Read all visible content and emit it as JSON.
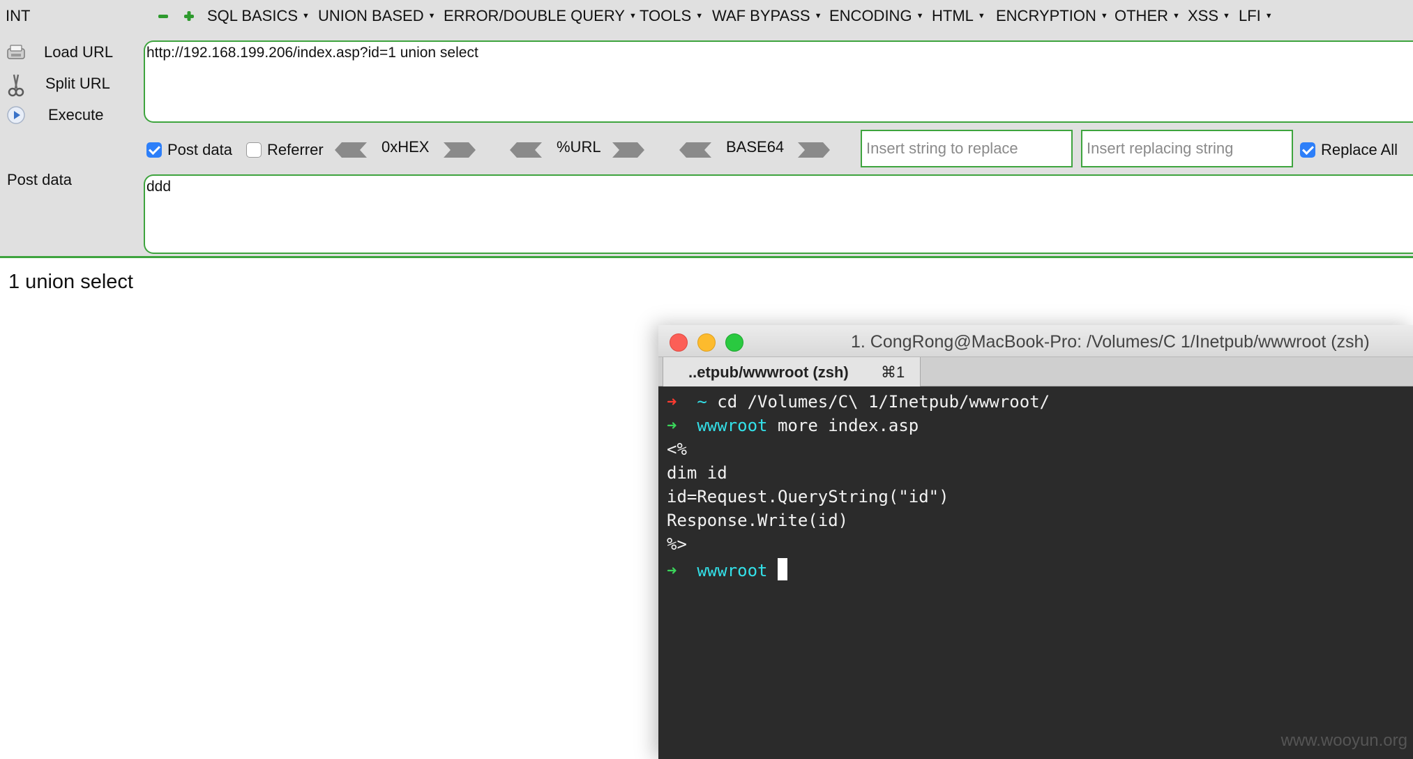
{
  "menubar": {
    "int_label": "INT",
    "items": [
      {
        "label": "SQL BASICS"
      },
      {
        "label": "UNION BASED"
      },
      {
        "label": "ERROR/DOUBLE QUERY"
      },
      {
        "label": "TOOLS"
      },
      {
        "label": "WAF BYPASS"
      },
      {
        "label": "ENCODING"
      },
      {
        "label": "HTML"
      },
      {
        "label": "ENCRYPTION"
      },
      {
        "label": "OTHER"
      },
      {
        "label": "XSS"
      },
      {
        "label": "LFI"
      }
    ]
  },
  "actions": {
    "load_url": "Load URL",
    "split_url": "Split URL",
    "execute": "Execute"
  },
  "url_field": {
    "value": "http://192.168.199.206/index.asp?id=1 union select"
  },
  "options": {
    "post_data": {
      "label": "Post data",
      "checked": true
    },
    "referrer": {
      "label": "Referrer",
      "checked": false
    },
    "hex_label": "0xHEX",
    "url_label": "%URL",
    "base64_label": "BASE64",
    "replace_placeholder": "Insert string to replace",
    "replacing_placeholder": "Insert replacing string",
    "replace_all": {
      "label": "Replace All",
      "checked": true
    }
  },
  "post_data": {
    "label": "Post data",
    "value": "ddd"
  },
  "result": {
    "text": "1 union select"
  },
  "terminal": {
    "title": "1. CongRong@MacBook-Pro: /Volumes/C 1/Inetpub/wwwroot (zsh)",
    "tab_label": "..etpub/wwwroot (zsh)",
    "tab_shortcut": "⌘1",
    "lines": {
      "l1_dir": "~",
      "l1_cmd": " cd /Volumes/C\\ 1/Inetpub/wwwroot/",
      "l2_dir": "wwwroot",
      "l2_cmd": " more index.asp",
      "l3": "<%",
      "l4": "dim id",
      "l5": "id=Request.QueryString(\"id\")",
      "l6": "Response.Write(id)",
      "l7": "%>",
      "l8_dir": "wwwroot"
    },
    "arrow_glyph": "➜",
    "colors": {
      "red_arrow": "#ff3b30",
      "green_arrow": "#3ad65a",
      "cyan": "#33e0e8"
    }
  },
  "watermark": "www.wooyun.org"
}
